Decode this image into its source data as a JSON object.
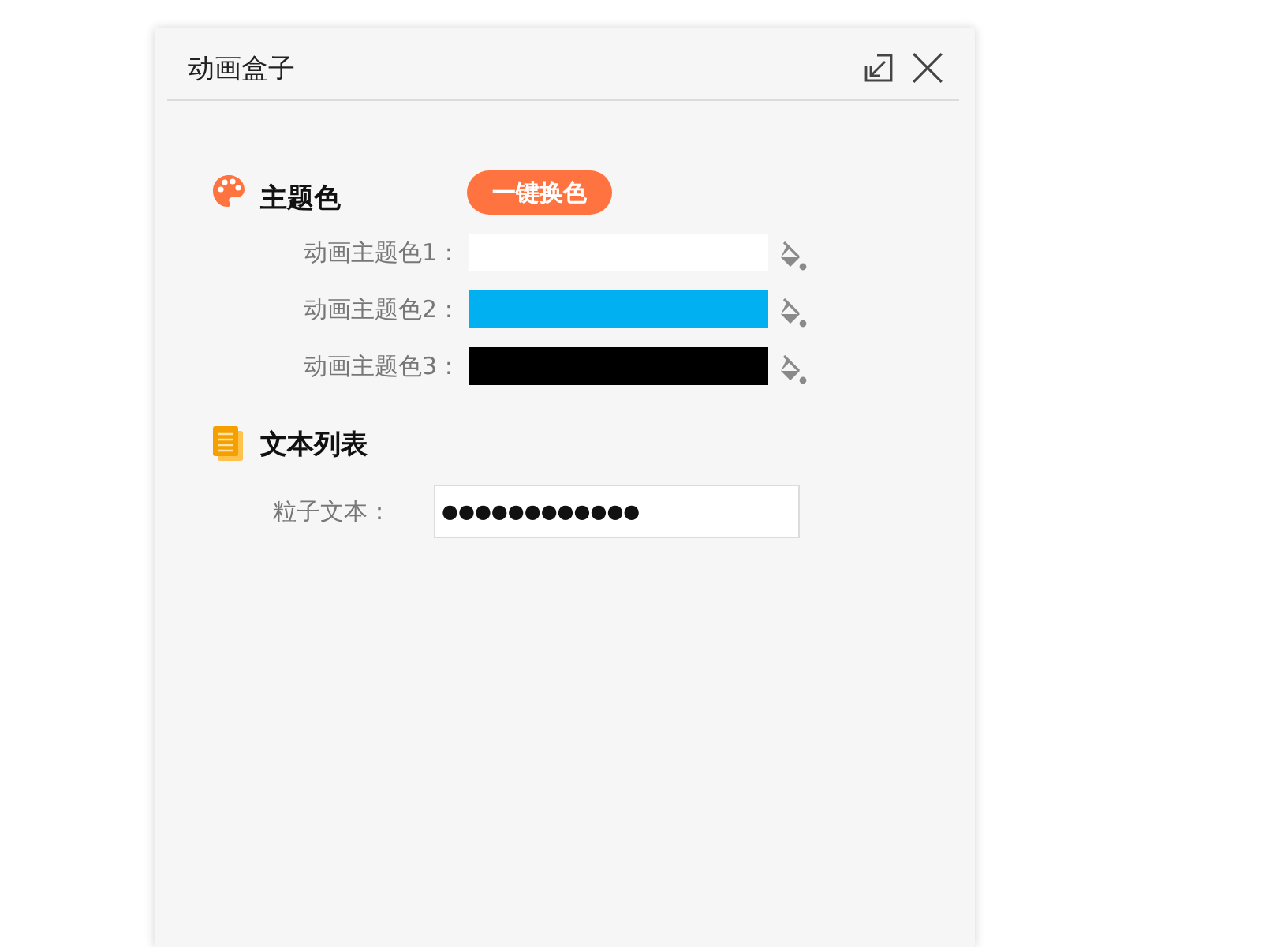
{
  "window": {
    "title": "动画盒子"
  },
  "sections": [
    {
      "kind": "colors",
      "title": "主题色",
      "button": "一键换色",
      "fields": [
        {
          "label": "动画主题色1：",
          "color": "#ffffff"
        },
        {
          "label": "动画主题色2：",
          "color": "#00b0f0"
        },
        {
          "label": "动画主题色3：",
          "color": "#000000"
        }
      ]
    },
    {
      "kind": "texts",
      "title": "文本列表",
      "fields": [
        {
          "label": "粒子文本：",
          "value": "●●●●●●●●●●●●"
        }
      ]
    }
  ]
}
